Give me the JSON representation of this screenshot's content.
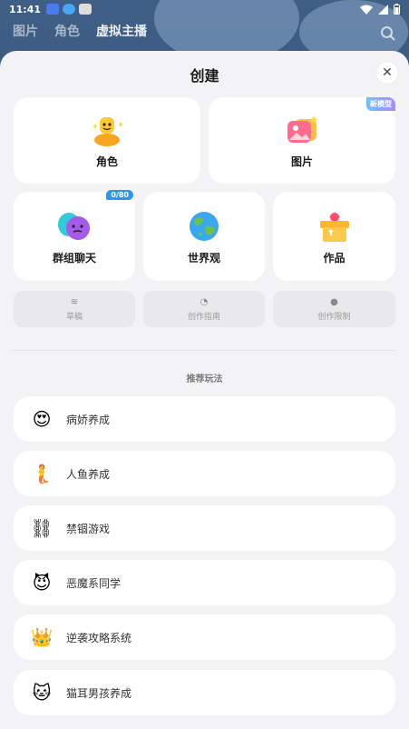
{
  "status": {
    "time": "11:41"
  },
  "back_tabs": [
    "图片",
    "角色",
    "虚拟主播"
  ],
  "sheet": {
    "title": "创建",
    "close_icon": "close-icon"
  },
  "cards": {
    "role": {
      "label": "角色",
      "icon": "character-emoji-icon"
    },
    "image": {
      "label": "图片",
      "icon": "image-icon",
      "badge": "新模型"
    },
    "group_chat": {
      "label": "群组聊天",
      "icon": "group-chat-icon",
      "badge": "0/80"
    },
    "worldview": {
      "label": "世界观",
      "icon": "globe-icon"
    },
    "works": {
      "label": "作品",
      "icon": "gift-box-icon"
    }
  },
  "small_buttons": {
    "draft": {
      "label": "草稿",
      "icon": "layers-icon"
    },
    "guide": {
      "label": "创作指南",
      "icon": "guide-icon"
    },
    "limits": {
      "label": "创作限制",
      "icon": "warning-icon"
    }
  },
  "recommend": {
    "title": "推荐玩法",
    "items": [
      {
        "label": "病娇养成",
        "emoji": "😍"
      },
      {
        "label": "人鱼养成",
        "emoji": "🧜"
      },
      {
        "label": "禁锢游戏",
        "emoji": "⛓"
      },
      {
        "label": "恶魔系同学",
        "emoji": "😈"
      },
      {
        "label": "逆袭攻略系统",
        "emoji": "👑"
      },
      {
        "label": "猫耳男孩养成",
        "emoji": "🐱"
      }
    ]
  },
  "colors": {
    "sheet_bg": "#f3f3f5",
    "card_bg": "#ffffff",
    "badge_blue": "#2f96f0"
  }
}
